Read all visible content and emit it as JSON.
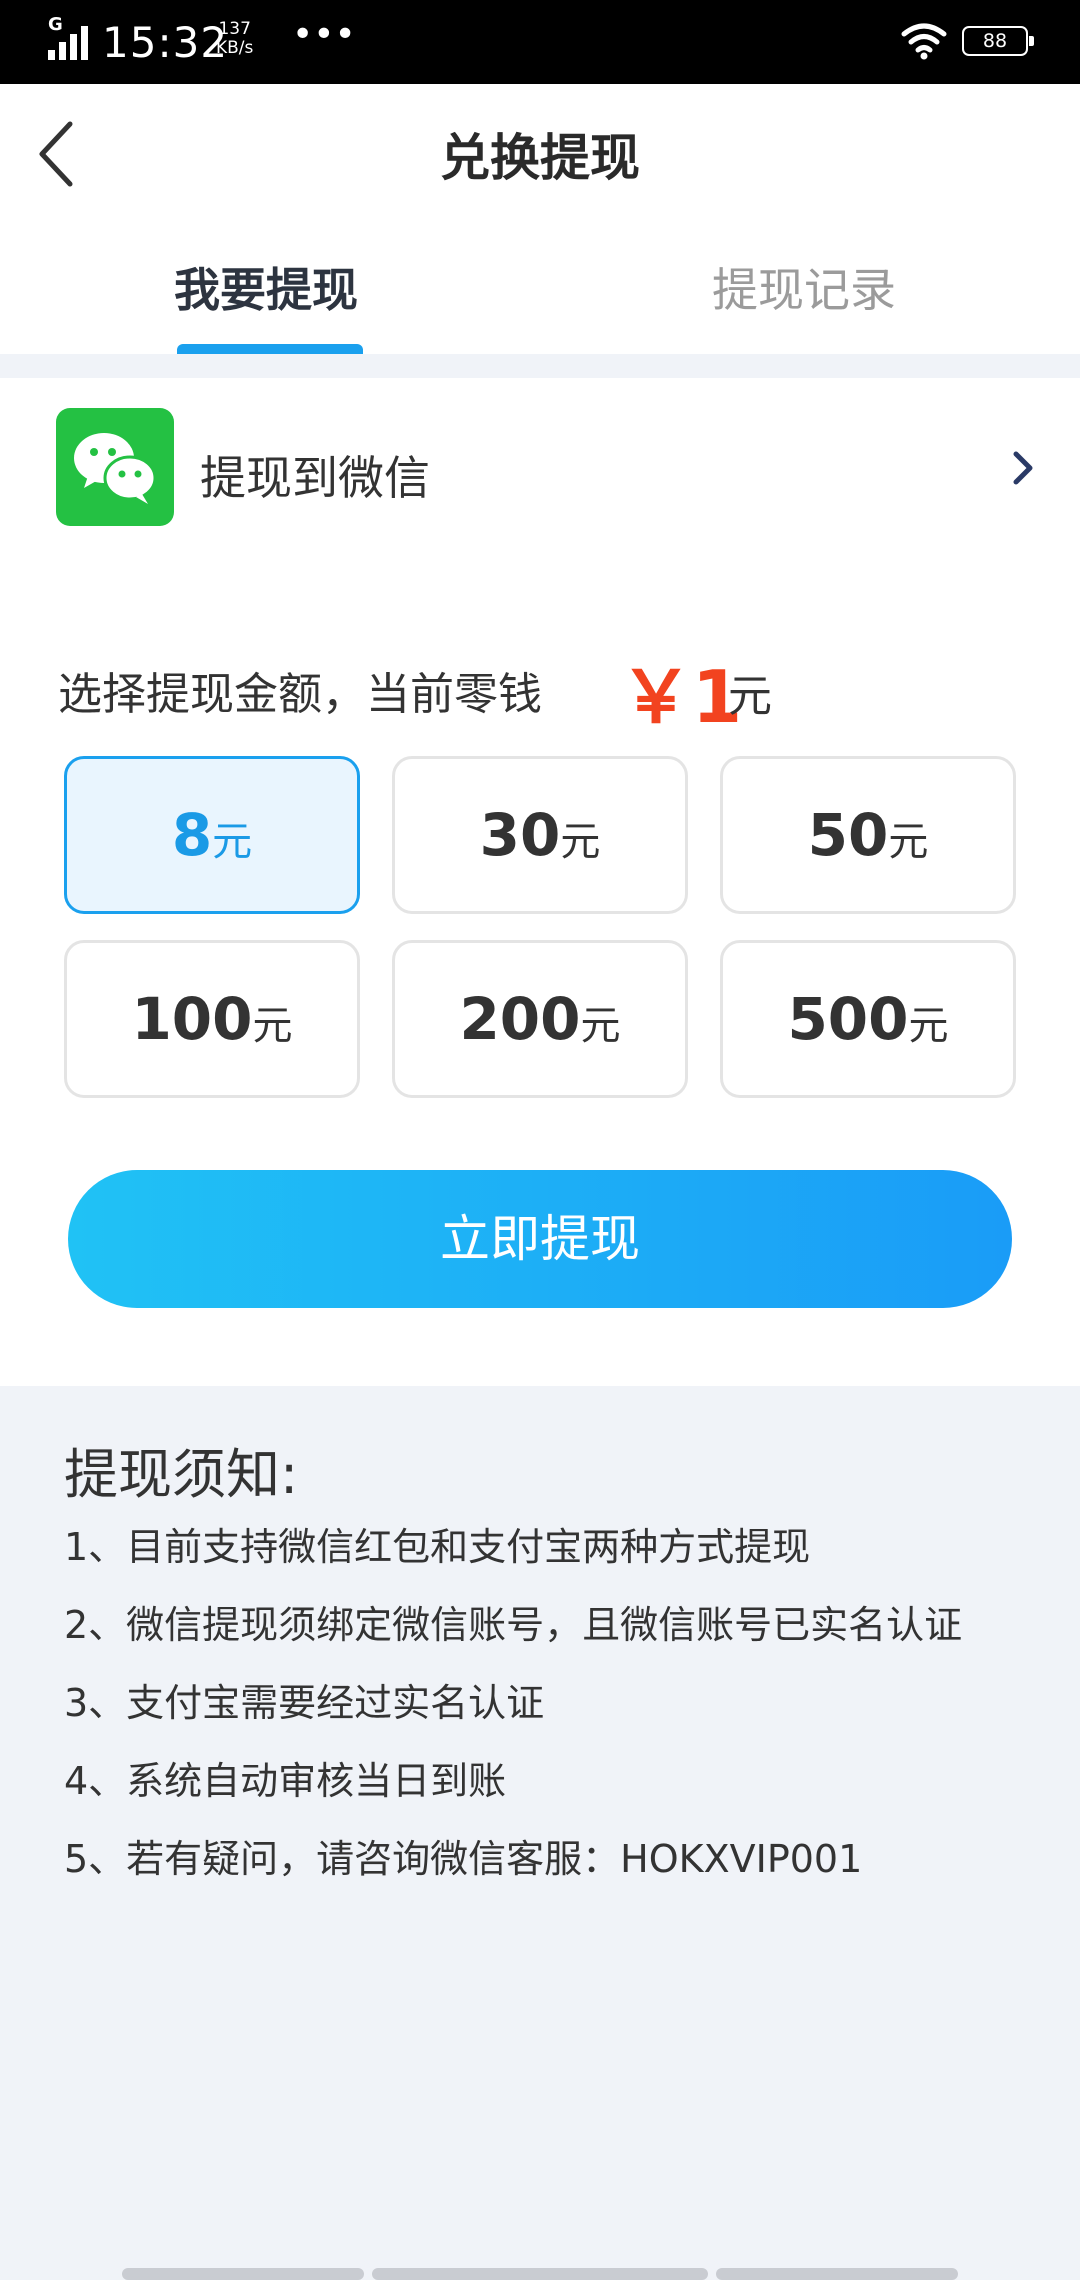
{
  "status_bar": {
    "network": "G",
    "time": "15:32",
    "speed_value": "137",
    "speed_unit": "KB/s",
    "more": "•••",
    "battery": "88"
  },
  "header": {
    "title": "兑换提现",
    "tabs": [
      {
        "label": "我要提现",
        "active": true
      },
      {
        "label": "提现记录",
        "active": false
      }
    ]
  },
  "withdraw_method": {
    "label": "提现到微信",
    "icon": "wechat-icon"
  },
  "amount": {
    "prompt": "选择提现金额，当前零钱",
    "balance": "￥1",
    "unit": "元"
  },
  "options": [
    {
      "value": "8",
      "unit": "元",
      "selected": true
    },
    {
      "value": "30",
      "unit": "元",
      "selected": false
    },
    {
      "value": "50",
      "unit": "元",
      "selected": false
    },
    {
      "value": "100",
      "unit": "元",
      "selected": false
    },
    {
      "value": "200",
      "unit": "元",
      "selected": false
    },
    {
      "value": "500",
      "unit": "元",
      "selected": false
    }
  ],
  "submit_label": "立即提现",
  "notice": {
    "title": "提现须知:",
    "items": [
      "1、目前支持微信红包和支付宝两种方式提现",
      "2、微信提现须绑定微信账号，且微信账号已实名认证",
      "3、支付宝需要经过实名认证",
      "4、系统自动审核当日到账",
      "5、若有疑问，请咨询微信客服：HOKXVIP001"
    ]
  },
  "colors": {
    "accent": "#1aa0ee",
    "balance": "#f2431f",
    "wechat_green": "#24c143"
  }
}
